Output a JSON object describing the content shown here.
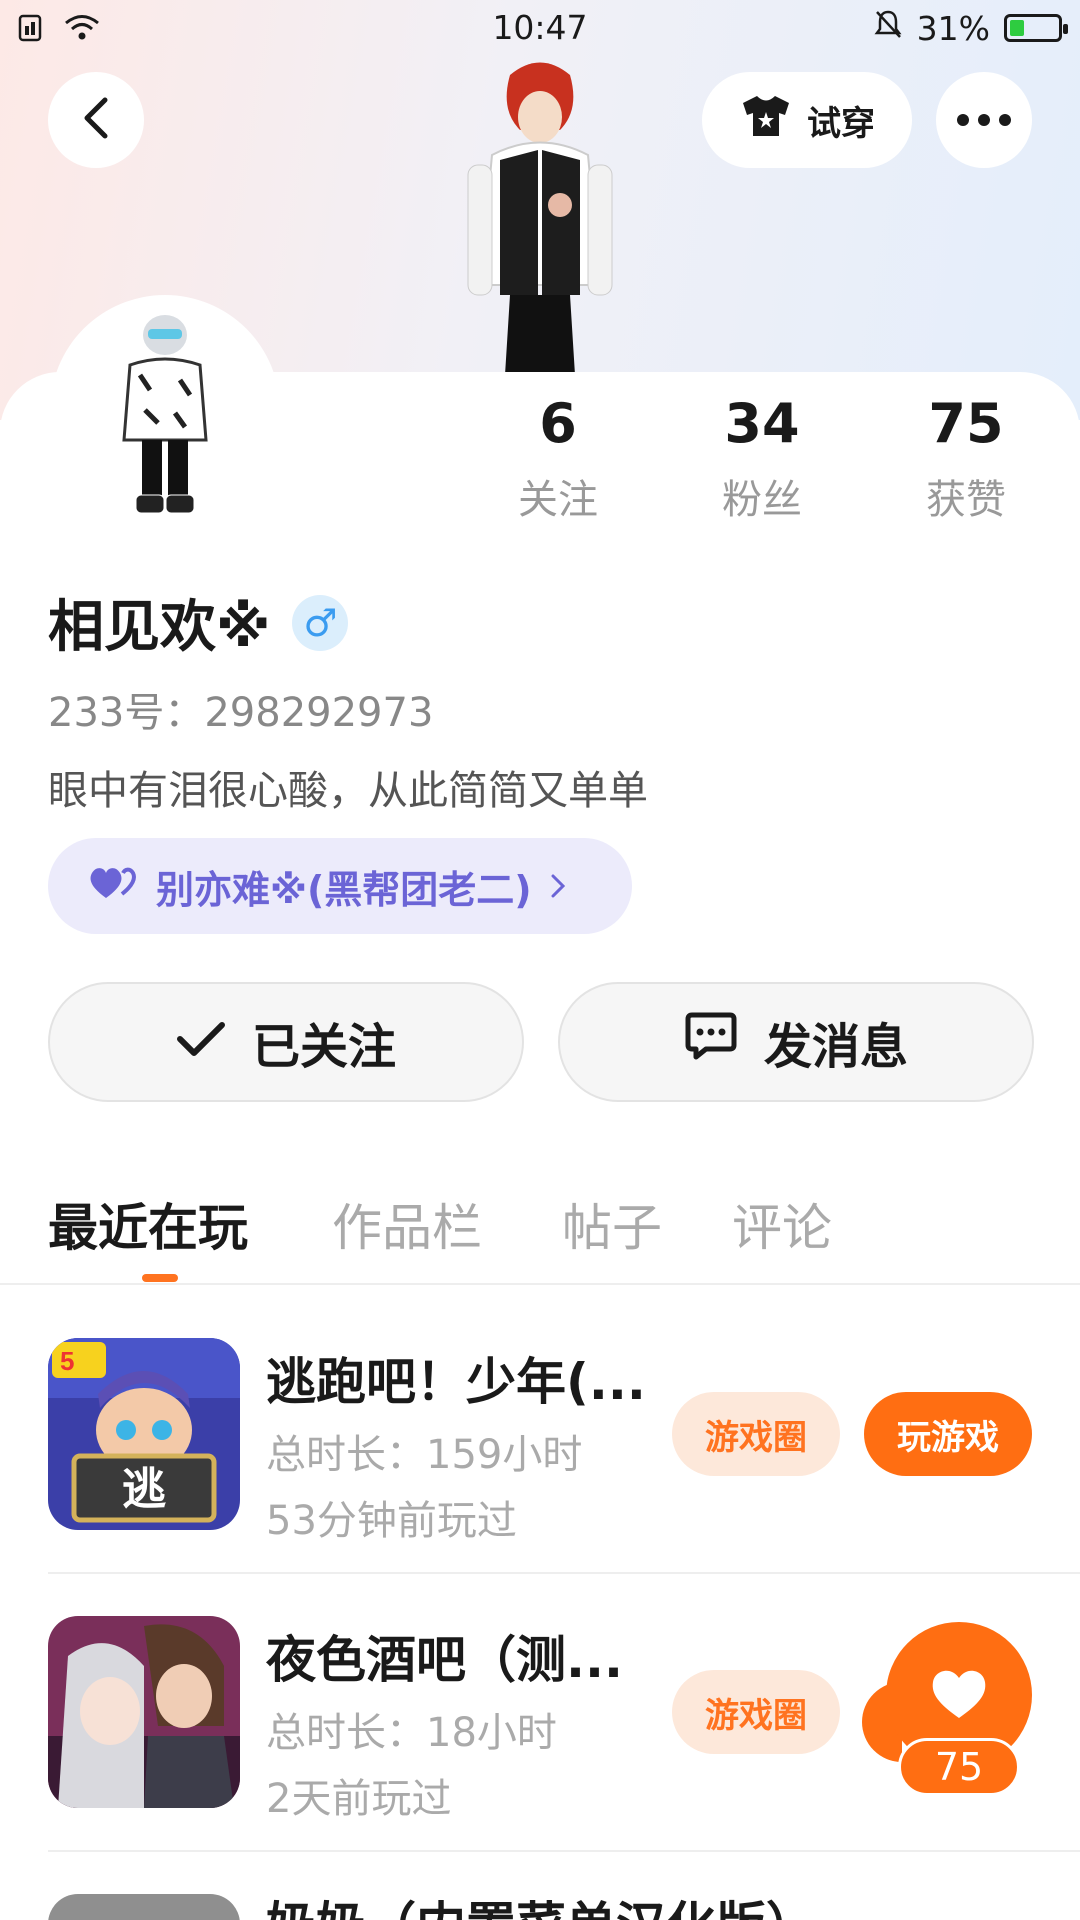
{
  "status_bar": {
    "time": "10:47",
    "battery_percent_text": "31%",
    "battery_level": 0.31,
    "icons": [
      "sim-icon",
      "wifi-icon",
      "bell-muted-icon",
      "battery-charging-icon"
    ]
  },
  "header": {
    "try_on_label": "试穿",
    "back_icon": "back-chevron-icon",
    "more_icon": "more-dots-icon"
  },
  "profile": {
    "name": "相见欢※",
    "gender_symbol": "♂",
    "uid": "233号：298292973",
    "bio": "眼中有泪很心酸，从此简简又单单",
    "relation_label": "别亦难※(黑帮团老二)",
    "stats": [
      {
        "value": "6",
        "label": "关注"
      },
      {
        "value": "34",
        "label": "粉丝"
      },
      {
        "value": "75",
        "label": "获赞"
      }
    ]
  },
  "actions": {
    "follow_label": "已关注",
    "message_label": "发消息"
  },
  "tabs": [
    {
      "label": "最近在玩",
      "active": true
    },
    {
      "label": "作品栏",
      "active": false
    },
    {
      "label": "帖子",
      "active": false
    },
    {
      "label": "评论",
      "active": false
    }
  ],
  "games": [
    {
      "title": "逃跑吧！少年(...",
      "duration": "总时长：159小时",
      "last_played": "53分钟前玩过",
      "circle_label": "游戏圈",
      "play_label": "玩游戏"
    },
    {
      "title": "夜色酒吧（测...",
      "duration": "总时长：18小时",
      "last_played": "2天前玩过",
      "circle_label": "游戏圈"
    },
    {
      "title": "奶奶（内置菜单汉化版）"
    }
  ],
  "like_float": {
    "count": "75"
  },
  "colors": {
    "accent": "#ff6e12",
    "accent_light": "#fde8da",
    "relation_bg": "#ecebfb",
    "relation_text": "#6b64d6",
    "gender_blue": "#3b9cf0"
  }
}
